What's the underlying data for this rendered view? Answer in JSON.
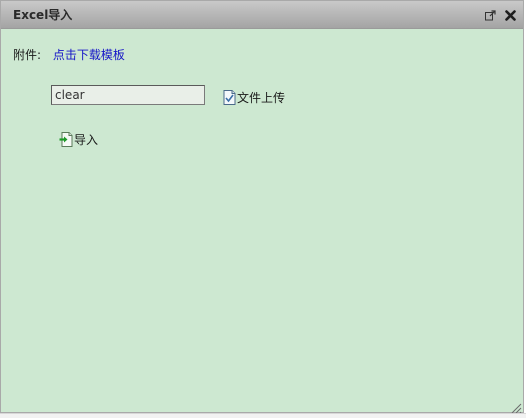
{
  "dialog": {
    "title": "Excel导入",
    "popout_icon": "popout-icon",
    "close_icon": "close-icon"
  },
  "attachment": {
    "label": "附件:",
    "download_link": "点击下载模板"
  },
  "file": {
    "value": "clear"
  },
  "upload": {
    "label": "文件上传",
    "icon": "upload-file-icon"
  },
  "import": {
    "label": "导入",
    "icon": "import-file-icon"
  },
  "colors": {
    "background": "#cde8d1",
    "titlebar": "#b3b3b3",
    "link": "#1515c8"
  }
}
